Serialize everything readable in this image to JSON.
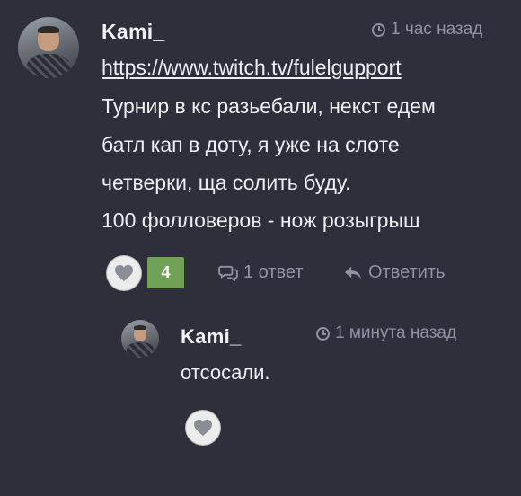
{
  "comment": {
    "author": "Kami_",
    "time": "1 час назад",
    "link": "https://www.twitch.tv/fulelgupport",
    "body_lines": [
      "Турнир в кс разьебали, некст едем",
      "батл кап в доту, я уже на слоте",
      "четверки, ща солить буду.",
      "100 фолловеров - нож розыгрыш"
    ],
    "like_count": "4",
    "replies_label": "1 ответ",
    "reply_action_label": "Ответить"
  },
  "reply": {
    "author": "Kami_",
    "time": "1 минута назад",
    "text": "отсосали."
  },
  "colors": {
    "background": "#2e2f3a",
    "like_count_bg": "#6fa254",
    "muted_text": "#8f93a3"
  },
  "icons": {
    "time": "clock-icon",
    "like": "heart-icon",
    "replies": "comments-icon",
    "reply": "reply-arrow-icon"
  }
}
